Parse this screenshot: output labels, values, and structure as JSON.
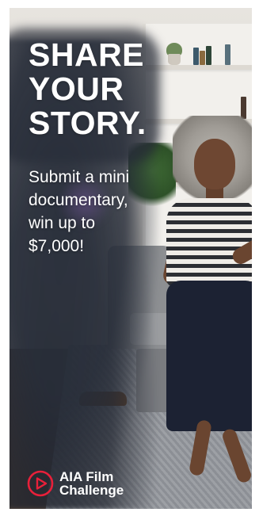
{
  "ad": {
    "headline_lines": [
      "SHARE",
      "YOUR",
      "STORY."
    ],
    "subtext_lines": [
      "Submit a mini",
      "documentary,",
      "win up to",
      "$7,000!"
    ],
    "brand_lines": [
      "AIA Film",
      "Challenge"
    ],
    "logo_icon": "play-circle-icon",
    "colors": {
      "text": "#ffffff",
      "logo_accent": "#e8203a",
      "frame_background": "#ffffff"
    }
  }
}
